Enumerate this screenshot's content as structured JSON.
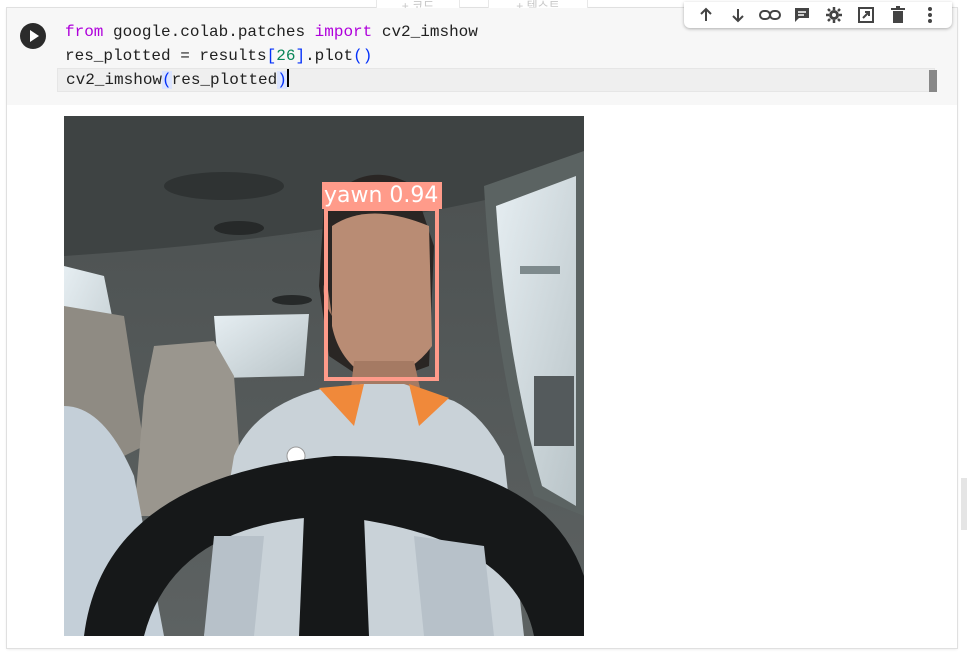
{
  "top_buttons": {
    "code_label": "+ 코드",
    "text_label": "+ 텍스트"
  },
  "toolbar": {
    "icons": [
      "arrow-up-icon",
      "arrow-down-icon",
      "link-icon",
      "comment-icon",
      "gear-icon",
      "mirror-cell-icon",
      "delete-icon",
      "more-vert-icon"
    ]
  },
  "code": {
    "line1": {
      "kw1": "from",
      "mod": " google.colab.patches ",
      "kw2": "import",
      "name": " cv2_imshow"
    },
    "line2": {
      "pre": "res_plotted = results",
      "ob": "[",
      "num": "26",
      "cb": "]",
      "mid": ".plot",
      "op": "(",
      "cp": ")"
    },
    "line3": {
      "pre": "cv2_imshow",
      "op": "(",
      "arg": "res_plotted",
      "cp": ")"
    }
  },
  "output": {
    "detection_label": "yawn 0.94",
    "detection_class": "yawn",
    "detection_confidence": 0.94,
    "box_color": "#ff9b8a"
  }
}
